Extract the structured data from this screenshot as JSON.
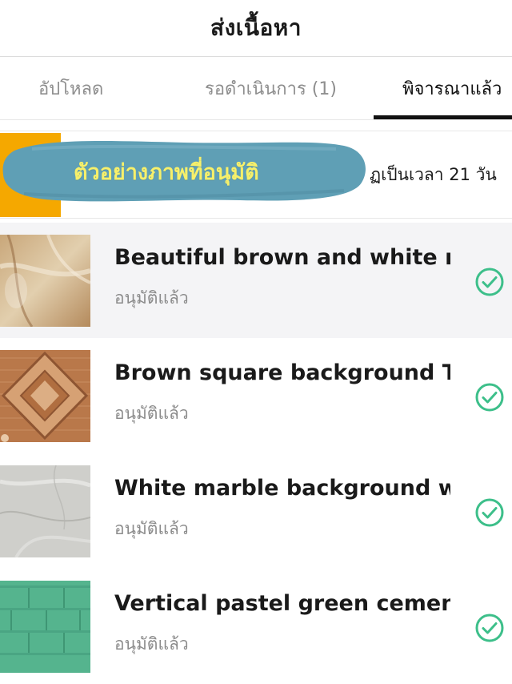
{
  "header": {
    "title": "ส่งเนื้อหา"
  },
  "tabs": [
    {
      "label": "อัปโหลด",
      "active": false
    },
    {
      "label": "รอดำเนินการ (1)",
      "active": false
    },
    {
      "label": "พิจารณาแล้ว",
      "active": true
    }
  ],
  "notice": {
    "text": "ฏเป็นเวลา 21 วัน",
    "accent_color": "#f5a800"
  },
  "overlay": {
    "text": "ตัวอย่างภาพที่อนุมัติ",
    "brush_color": "#5f9fb5",
    "text_color": "#f7f06a"
  },
  "items": [
    {
      "title": "Beautiful brown and white m...",
      "status": "อนุมัติแล้ว",
      "thumbnail": "brown-white-marble",
      "status_icon": "check-circle-icon"
    },
    {
      "title": "Brown square background Ti...",
      "status": "อนุมัติแล้ว",
      "thumbnail": "brown-square-tile",
      "status_icon": "check-circle-icon"
    },
    {
      "title": "White marble background wi...",
      "status": "อนุมัติแล้ว",
      "thumbnail": "white-marble",
      "status_icon": "check-circle-icon"
    },
    {
      "title": "Vertical pastel green cemen...",
      "status": "อนุมัติแล้ว",
      "thumbnail": "green-cement",
      "status_icon": "check-circle-icon"
    }
  ],
  "colors": {
    "approved_green": "#3dbf8a",
    "active_tab": "#111111"
  }
}
